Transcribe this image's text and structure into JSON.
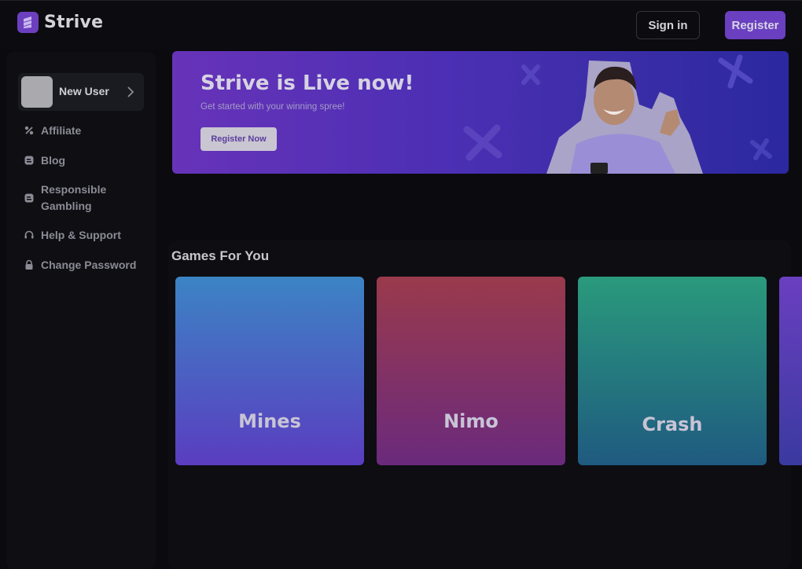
{
  "header": {
    "brand": "Strive",
    "sign_in_label": "Sign in",
    "register_label": "Register"
  },
  "sidebar": {
    "user_name": "New User",
    "items": [
      {
        "label": "Affiliate",
        "icon": "affiliate-icon"
      },
      {
        "label": "Blog",
        "icon": "blog-icon"
      },
      {
        "label": "Responsible Gambling",
        "icon": "responsible-gambling-icon"
      },
      {
        "label": "Help & Support",
        "icon": "headset-icon"
      },
      {
        "label": "Change Password",
        "icon": "lock-icon"
      }
    ]
  },
  "banner": {
    "title": "Strive is Live now!",
    "subtitle": "Get started with your winning spree!",
    "cta_label": "Register Now"
  },
  "games_section": {
    "title": "Games For You",
    "games": [
      {
        "name": "Mines",
        "color_top": "#3c84c4",
        "color_bottom": "#5a3dc0"
      },
      {
        "name": "Nimo",
        "color_top": "#9a3a4c",
        "color_bottom": "#6a2a7c"
      },
      {
        "name": "Crash",
        "color_top": "#2a9a7c",
        "color_bottom": "#1f5a80"
      }
    ]
  },
  "colors": {
    "accent": "#6a3fc0",
    "background": "#0b0b0f"
  }
}
